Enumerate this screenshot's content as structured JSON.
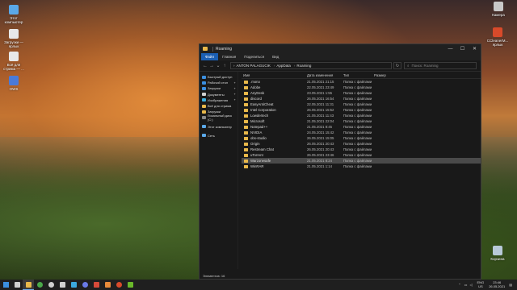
{
  "desktop": {
    "left_icons": [
      {
        "label": "Этот компьютер",
        "color": "#5aa8e8"
      },
      {
        "label": "Загрузки — ярлык",
        "color": "#e8e8e8"
      },
      {
        "label": "Всё для стрима — ...",
        "color": "#e8e8e8"
      },
      {
        "label": "OWS",
        "color": "#4a7ad8"
      }
    ],
    "right_icons": [
      {
        "label": "Камера",
        "color": "#c8c8c8"
      },
      {
        "label": "CCleanerM... ярлык",
        "color": "#d84a2a"
      },
      {
        "label": "Корзина",
        "color": "#b8c8d8"
      }
    ]
  },
  "window": {
    "title": "Roaming",
    "controls": {
      "minimize": "—",
      "maximize": "☐",
      "close": "✕"
    },
    "ribbon_tabs": [
      "Файл",
      "Главная",
      "Поделиться",
      "Вид"
    ],
    "address": {
      "crumbs": [
        "ANTON PALAGUCIK",
        "AppData",
        "Roaming"
      ]
    },
    "search_placeholder": "Поиск: Roaming",
    "sidebar": [
      {
        "label": "Быстрый доступ",
        "color": "#3b8fe0",
        "pinned": false
      },
      {
        "label": "Рабочий стол",
        "color": "#3b8fe0",
        "pinned": true
      },
      {
        "label": "Загрузки",
        "color": "#3b8fe0",
        "pinned": true
      },
      {
        "label": "Документы",
        "color": "#d0d0d0",
        "pinned": true
      },
      {
        "label": "Изображения",
        "color": "#3bb0e0",
        "pinned": true
      },
      {
        "label": "Всё для стрима",
        "color": "#e8b84a",
        "pinned": false
      },
      {
        "label": "Загрузки",
        "color": "#e8b84a",
        "pinned": false
      },
      {
        "label": "Локальный диск (С:)",
        "color": "#888888",
        "pinned": false
      },
      {
        "label": "Этот компьютер",
        "color": "#5aa8e8",
        "pinned": false,
        "gap": true
      },
      {
        "label": "Сеть",
        "color": "#5aa8e8",
        "pinned": false,
        "gap": true
      }
    ],
    "columns": {
      "name": "Имя",
      "date": "Дата изменения",
      "type": "Тип",
      "size": "Размер"
    },
    "files": [
      {
        "name": ".mono",
        "date": "21.05.2021 21:15",
        "type": "Папка с файлами"
      },
      {
        "name": "Adobe",
        "date": "22.05.2021 23:49",
        "type": "Папка с файлами"
      },
      {
        "name": "AnyDesk",
        "date": "23.05.2021 1:55",
        "type": "Папка с файлами"
      },
      {
        "name": "discord",
        "date": "26.05.2021 16:54",
        "type": "Папка с файлами"
      },
      {
        "name": "EasyAntiCheat",
        "date": "22.05.2021 11:31",
        "type": "Папка с файлами"
      },
      {
        "name": "Intel Corporation",
        "date": "26.05.2021 15:52",
        "type": "Папка с файлами"
      },
      {
        "name": "Lowdertech",
        "date": "21.05.2021 11:43",
        "type": "Папка с файлами"
      },
      {
        "name": "Microsoft",
        "date": "21.05.2021 22:04",
        "type": "Папка с файлами"
      },
      {
        "name": "Notepad++",
        "date": "21.05.2021 8:45",
        "type": "Папка с файлами"
      },
      {
        "name": "NVIDIA",
        "date": "24.05.2021 15:42",
        "type": "Папка с файлами"
      },
      {
        "name": "obs-studio",
        "date": "26.05.2021 15:05",
        "type": "Папка с файлами"
      },
      {
        "name": "Origin",
        "date": "26.05.2021 20:43",
        "type": "Папка с файлами"
      },
      {
        "name": "Restream Chat",
        "date": "26.05.2021 20:43",
        "type": "Папка с файлами"
      },
      {
        "name": "uTorrent",
        "date": "26.05.2021 23:46",
        "type": "Папка с файлами"
      },
      {
        "name": "Warzonesafe",
        "date": "21.05.2021 8:24",
        "type": "Папка с файлами",
        "selected": true
      },
      {
        "name": "WinRAR",
        "date": "21.05.2021 1:14",
        "type": "Папка с файлами"
      }
    ],
    "status": "Элементов: 16"
  },
  "taskbar": {
    "apps": [
      {
        "name": "start",
        "color": "#3b8fe0"
      },
      {
        "name": "search",
        "color": "#d0d0d0"
      },
      {
        "name": "explorer",
        "color": "#e8b84a",
        "active": true
      },
      {
        "name": "chrome",
        "color": "#4aa84a"
      },
      {
        "name": "obs",
        "color": "#d0d0d0"
      },
      {
        "name": "settings",
        "color": "#d0d0d0"
      },
      {
        "name": "telegram",
        "color": "#3ba8e0"
      },
      {
        "name": "discord",
        "color": "#6a7ae8"
      },
      {
        "name": "app-red",
        "color": "#d84a3a"
      },
      {
        "name": "app-orange",
        "color": "#e88a3a"
      },
      {
        "name": "ccleaner",
        "color": "#d84a2a"
      },
      {
        "name": "nvidia",
        "color": "#6ab82a"
      }
    ],
    "lang_line1": "ENG",
    "lang_line2": "US",
    "time": "23:46",
    "date": "26.05.2021"
  }
}
